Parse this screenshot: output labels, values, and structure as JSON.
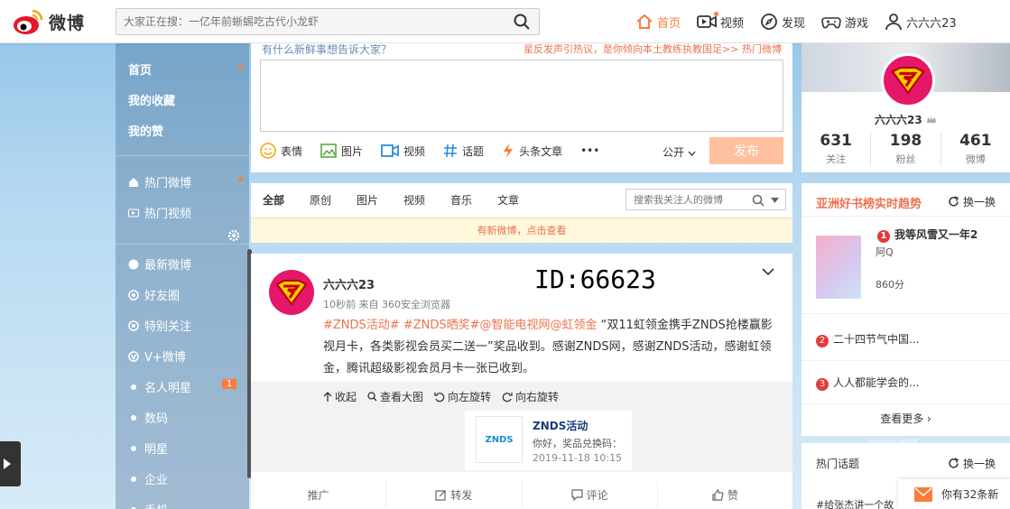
{
  "header": {
    "logo_text": "微博",
    "search_placeholder": "大家正在搜：一亿年前蜥蜴吃古代小龙虾",
    "nav": [
      {
        "label": "首页",
        "icon": "home-icon"
      },
      {
        "label": "视频",
        "icon": "video-icon"
      },
      {
        "label": "发现",
        "icon": "compass-icon"
      },
      {
        "label": "游戏",
        "icon": "gamepad-icon"
      },
      {
        "label": "六六六23",
        "icon": "user-icon"
      }
    ]
  },
  "leftnav": {
    "top_items": [
      "首页",
      "我的收藏",
      "我的赞"
    ],
    "hot_items": [
      "热门微博",
      "热门视频"
    ],
    "group_items": [
      "最新微博",
      "好友圈",
      "特别关注",
      "V+微博"
    ],
    "sub_items": [
      "名人明星",
      "数码",
      "明星",
      "企业",
      "手机"
    ],
    "badge": "1"
  },
  "publisher": {
    "hint": "有什么新鲜事想告诉大家？",
    "hot_tip": "星反发声引热议，是你倾向本土教练执教国足>>  热门微博",
    "tools": [
      "表情",
      "图片",
      "视频",
      "话题",
      "头条文章"
    ],
    "more": "•••",
    "visibility": "公开",
    "submit": "发布"
  },
  "feed_tabs": {
    "tabs": [
      "全部",
      "原创",
      "图片",
      "视频",
      "音乐",
      "文章"
    ],
    "filter_placeholder": "搜索我关注人的微博",
    "notice": "有新微博，点击查看"
  },
  "post": {
    "author": "六六六23",
    "id_label": "ID:66623",
    "meta": "10秒前 来自 360安全浏览器",
    "tags": "#ZNDS活动# #ZNDS晒奖#@智能电视网@虹领金",
    "text": " “双11虹领金携手ZNDS抢楼赢影视月卡，各类影视会员买二送一”奖品收到。感谢ZNDS网，感谢ZNDS活动，感谢虹领金，腾讯超级影视会员月卡一张已收到。",
    "media_tools": [
      "收起",
      "查看大图",
      "向左旋转",
      "向右旋转"
    ],
    "share": {
      "logo": "ZNDS",
      "title": "ZNDS活动",
      "desc": "你好，奖品兑换码：",
      "time": "2019-11-18 10:15"
    },
    "actions": [
      "推广",
      "转发",
      "评论",
      "赞"
    ]
  },
  "profile": {
    "name": "六六六23",
    "stats": [
      {
        "num": "631",
        "label": "关注"
      },
      {
        "num": "198",
        "label": "粉丝"
      },
      {
        "num": "461",
        "label": "微博"
      }
    ]
  },
  "ranking": {
    "title": "亚洲好书榜实时趋势",
    "refresh": "换一换",
    "first": {
      "rank": "1",
      "title": "我等风雪又一年2",
      "author": "阿Q",
      "score": "860分"
    },
    "items": [
      {
        "rank": "2",
        "title": "二十四节气中国..."
      },
      {
        "rank": "3",
        "title": "人人都能学会的..."
      }
    ],
    "more": "查看更多 ›"
  },
  "topic": {
    "title": "热门话题",
    "refresh": "换一换",
    "item": "#给张杰讲一个故"
  },
  "message": "你有32条新",
  "watermark": "智能电视网",
  "colors": {
    "accent": "#fa7d3c",
    "link": "#eb7350",
    "avatar": "#e5176b"
  }
}
